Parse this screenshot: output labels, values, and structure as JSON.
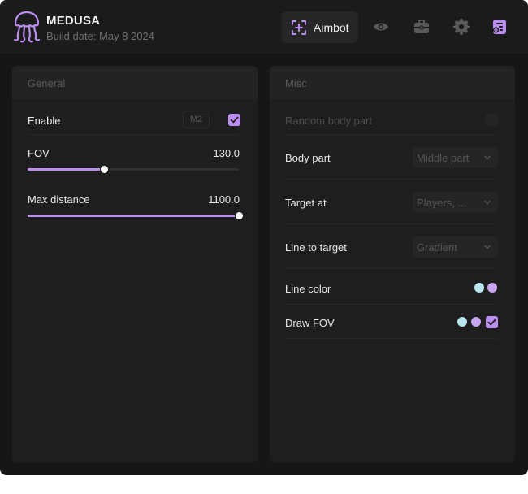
{
  "app": {
    "name": "MEDUSA",
    "build_date": "Build date: May 8 2024"
  },
  "tabs": [
    {
      "label": "Aimbot",
      "icon": "crosshair-icon",
      "active": true
    },
    {
      "icon": "eye-icon",
      "active": false
    },
    {
      "icon": "briefcase-icon",
      "active": false
    },
    {
      "icon": "gear-icon",
      "active": false
    },
    {
      "icon": "settings-list-icon",
      "active": false
    }
  ],
  "general": {
    "title": "General",
    "enable": {
      "label": "Enable",
      "keybind": "M2",
      "checked": true
    },
    "fov": {
      "label": "FOV",
      "value": "130.0",
      "fraction": 0.365
    },
    "max_distance": {
      "label": "Max distance",
      "value": "1100.0",
      "fraction": 1.0
    }
  },
  "misc": {
    "title": "Misc",
    "random_body_part": {
      "label": "Random body part",
      "checked": false,
      "disabled": true
    },
    "body_part": {
      "label": "Body part",
      "selected": "Middle part"
    },
    "target_at": {
      "label": "Target at",
      "selected": "Players, ..."
    },
    "line_to_target": {
      "label": "Line to target",
      "selected": "Gradient"
    },
    "line_color": {
      "label": "Line color",
      "colors": [
        "#b9e6ef",
        "#c7a6ef"
      ]
    },
    "draw_fov": {
      "label": "Draw FOV",
      "colors": [
        "#b9e6ef",
        "#c7a6ef"
      ],
      "checked": true
    }
  },
  "colors": {
    "accent": "#bb8ef2",
    "background": "#161616",
    "panel": "#1e1e1e"
  }
}
